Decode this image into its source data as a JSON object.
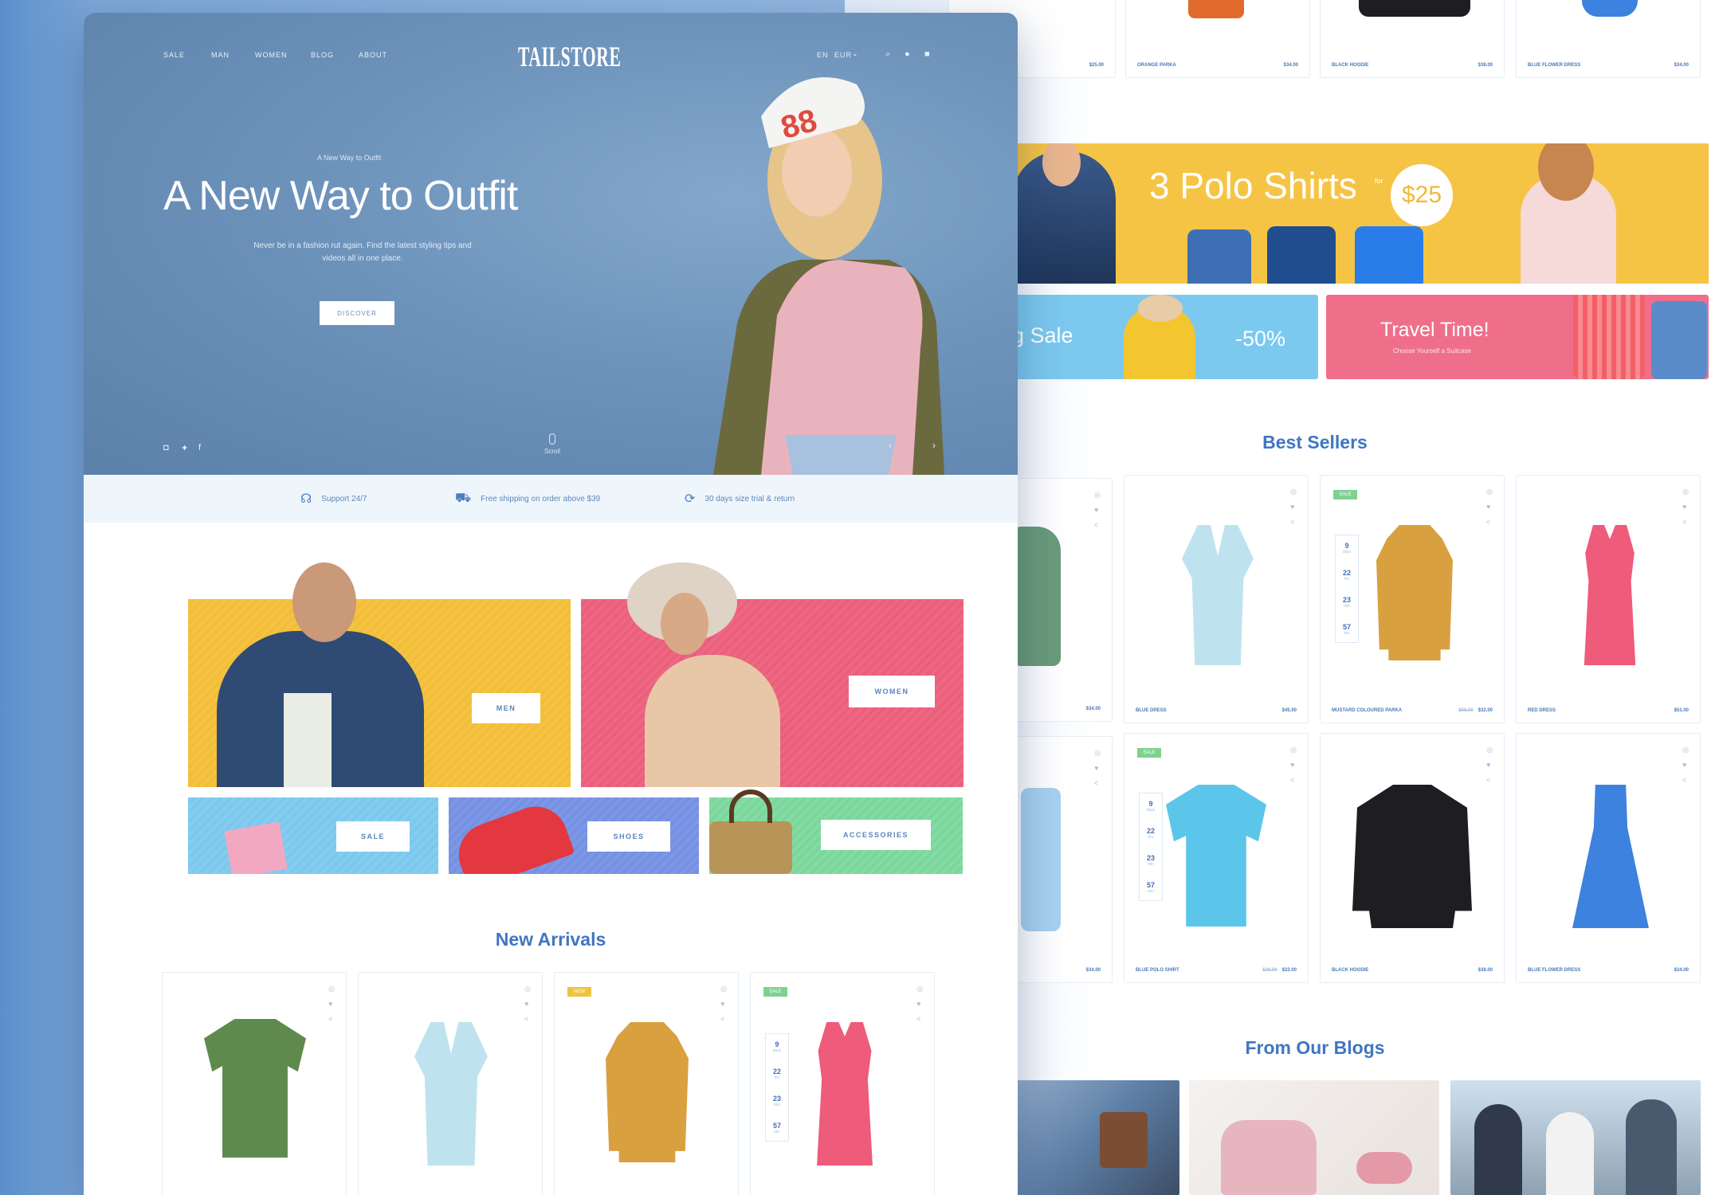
{
  "nav": {
    "links": [
      "Sale",
      "Man",
      "Women",
      "Blog",
      "About"
    ],
    "logo": "TAILSTORE",
    "lang": "EN",
    "currency": "EUR"
  },
  "hero": {
    "kicker": "A New Way to Outfit",
    "title": "A New Way to Outfit",
    "description": "Never be in a fashion rut again. Find the latest styling tips and videos all in one place.",
    "button": "Discover",
    "scroll": "Scroll"
  },
  "features": [
    {
      "icon": "headset-icon",
      "text": "Support 24/7"
    },
    {
      "icon": "truck-icon",
      "text": "Free shipping on order above $39"
    },
    {
      "icon": "refresh-icon",
      "text": "30 days size trial & return"
    }
  ],
  "categories": {
    "men": "Men",
    "women": "Women",
    "sale": "Sale",
    "shoes": "Shoes",
    "accessories": "Accessories"
  },
  "new_arrivals": {
    "title": "New Arrivals",
    "products": [
      {
        "badge": "",
        "color": "#5f8a4e"
      },
      {
        "badge": "",
        "color": "#bfe3ee"
      },
      {
        "badge": "New",
        "badge_color": "#f0c33c",
        "color": "#d9a040"
      },
      {
        "badge": "Sale",
        "badge_color": "#7fd18f",
        "color": "#ef5b7a",
        "timer": [
          "9",
          "22",
          "23",
          "57"
        ]
      }
    ]
  },
  "top_row": [
    {
      "name": "",
      "price": "$25.00"
    },
    {
      "name": "Orange Parka",
      "price": "$34.00"
    },
    {
      "name": "Black Hoodie",
      "price": "$38.00"
    },
    {
      "name": "Blue Flower Dress",
      "price": "$34.00"
    }
  ],
  "promo": {
    "polo_title": "3 Polo Shirts",
    "polo_for": "for",
    "polo_price": "$25",
    "sale_text": "g Sale",
    "sale_pct": "-50%",
    "travel_title": "Travel Time!",
    "travel_sub": "Choose Yourself a Suitcase"
  },
  "best_sellers": {
    "title": "Best Sellers",
    "row1": [
      {
        "name": "",
        "price": "$34.00"
      },
      {
        "name": "Blue Dress",
        "price": "$45.00",
        "color": "#bfe3ee"
      },
      {
        "name": "Mustard Coloured Parka",
        "old_price": "$58.00",
        "price": "$32.00",
        "badge": "Sale",
        "color": "#d9a040",
        "timer": [
          "9",
          "22",
          "23",
          "57"
        ]
      },
      {
        "name": "Red Dress",
        "price": "$51.00",
        "color": "#ef5b7a"
      }
    ],
    "row2": [
      {
        "name": "",
        "price": "$34.00"
      },
      {
        "name": "Blue Polo Shirt",
        "old_price": "$29.00",
        "price": "$22.00",
        "badge": "Sale",
        "color": "#5cc6ea",
        "timer": [
          "9",
          "22",
          "23",
          "57"
        ]
      },
      {
        "name": "Black Hoodie",
        "price": "$38.00",
        "color": "#1e1e22"
      },
      {
        "name": "Blue Flower Dress",
        "price": "$34.00",
        "color": "#3d82df"
      }
    ]
  },
  "blogs": {
    "title": "From Our Blogs"
  },
  "timer_units": [
    "days",
    "hrs",
    "min",
    "sec"
  ]
}
